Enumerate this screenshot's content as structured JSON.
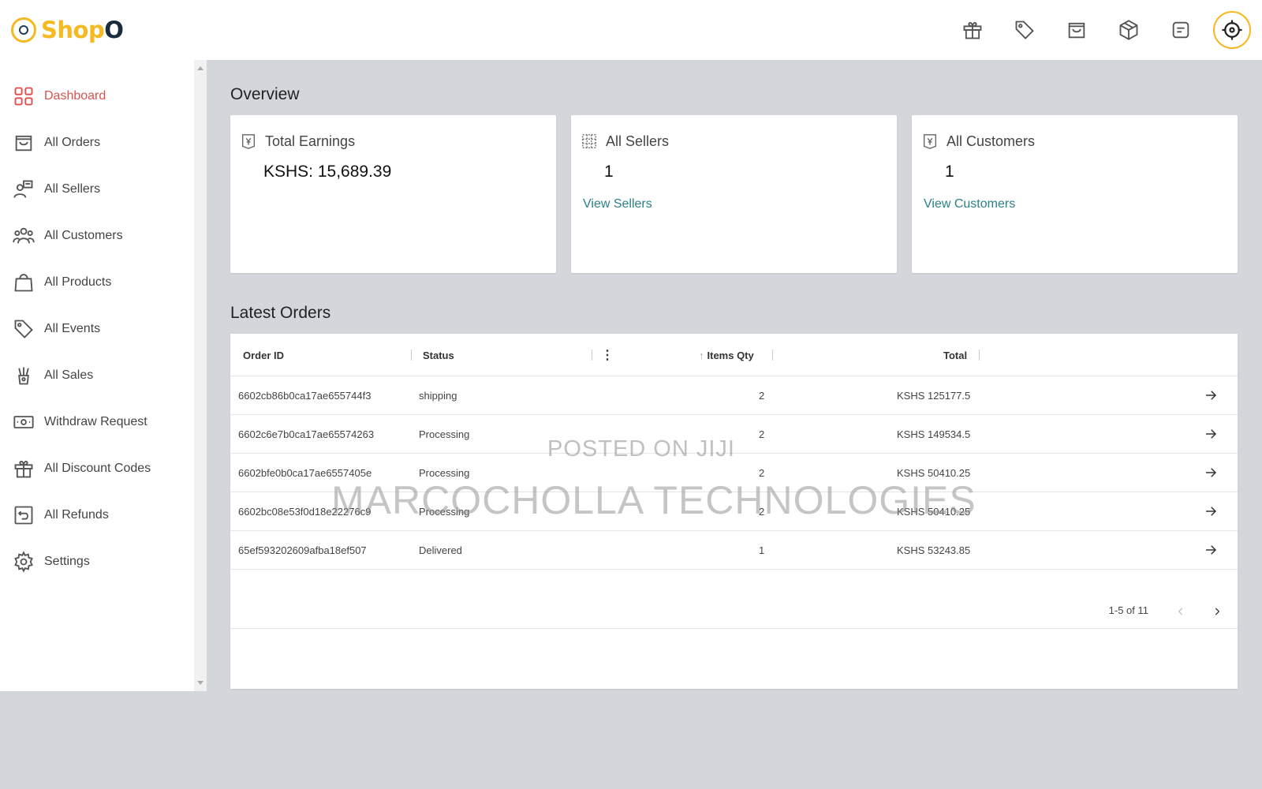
{
  "brand": {
    "name_part1": "Shop",
    "name_part2": "O",
    "accent": "#f5b921"
  },
  "header": {
    "icons": [
      "gift-icon",
      "tag-icon",
      "shopping-bag-icon",
      "package-icon",
      "message-icon"
    ],
    "avatar": "crosshair-avatar-icon"
  },
  "sidebar": {
    "items": [
      {
        "label": "Dashboard",
        "icon": "dashboard-grid-icon",
        "active": true
      },
      {
        "label": "All Orders",
        "icon": "shopping-bag-icon"
      },
      {
        "label": "All Sellers",
        "icon": "seller-icon"
      },
      {
        "label": "All Customers",
        "icon": "customers-icon"
      },
      {
        "label": "All Products",
        "icon": "bag-icon"
      },
      {
        "label": "All Events",
        "icon": "tag-icon"
      },
      {
        "label": "All Sales",
        "icon": "sales-icon"
      },
      {
        "label": "Withdraw Request",
        "icon": "money-icon"
      },
      {
        "label": "All Discount Codes",
        "icon": "gift-icon"
      },
      {
        "label": "All Refunds",
        "icon": "refund-icon"
      },
      {
        "label": "Settings",
        "icon": "gear-icon"
      }
    ]
  },
  "overview": {
    "title": "Overview",
    "cards": [
      {
        "title": "Total Earnings",
        "value": "KSHS: 15,689.39",
        "link": ""
      },
      {
        "title": "All Sellers",
        "value": "1",
        "link": "View Sellers"
      },
      {
        "title": "All Customers",
        "value": "1",
        "link": "View Customers"
      }
    ]
  },
  "orders": {
    "title": "Latest Orders",
    "columns": {
      "id": "Order ID",
      "status": "Status",
      "qty": "Items Qty",
      "total": "Total"
    },
    "rows": [
      {
        "id": "6602cb86b0ca17ae655744f3",
        "status": "shipping",
        "qty": "2",
        "total": "KSHS 125177.5"
      },
      {
        "id": "6602c6e7b0ca17ae65574263",
        "status": "Processing",
        "qty": "2",
        "total": "KSHS 149534.5"
      },
      {
        "id": "6602bfe0b0ca17ae6557405e",
        "status": "Processing",
        "qty": "2",
        "total": "KSHS 50410.25"
      },
      {
        "id": "6602bc08e53f0d18e22276c9",
        "status": "Processing",
        "qty": "2",
        "total": "KSHS 50410.25"
      },
      {
        "id": "65ef593202609afba18ef507",
        "status": "Delivered",
        "qty": "1",
        "total": "KSHS 53243.85"
      }
    ],
    "pagination": "1-5 of 11"
  },
  "watermark": {
    "line1": "POSTED ON JIJI",
    "line2": "MARCOCHOLLA TECHNOLOGIES"
  }
}
